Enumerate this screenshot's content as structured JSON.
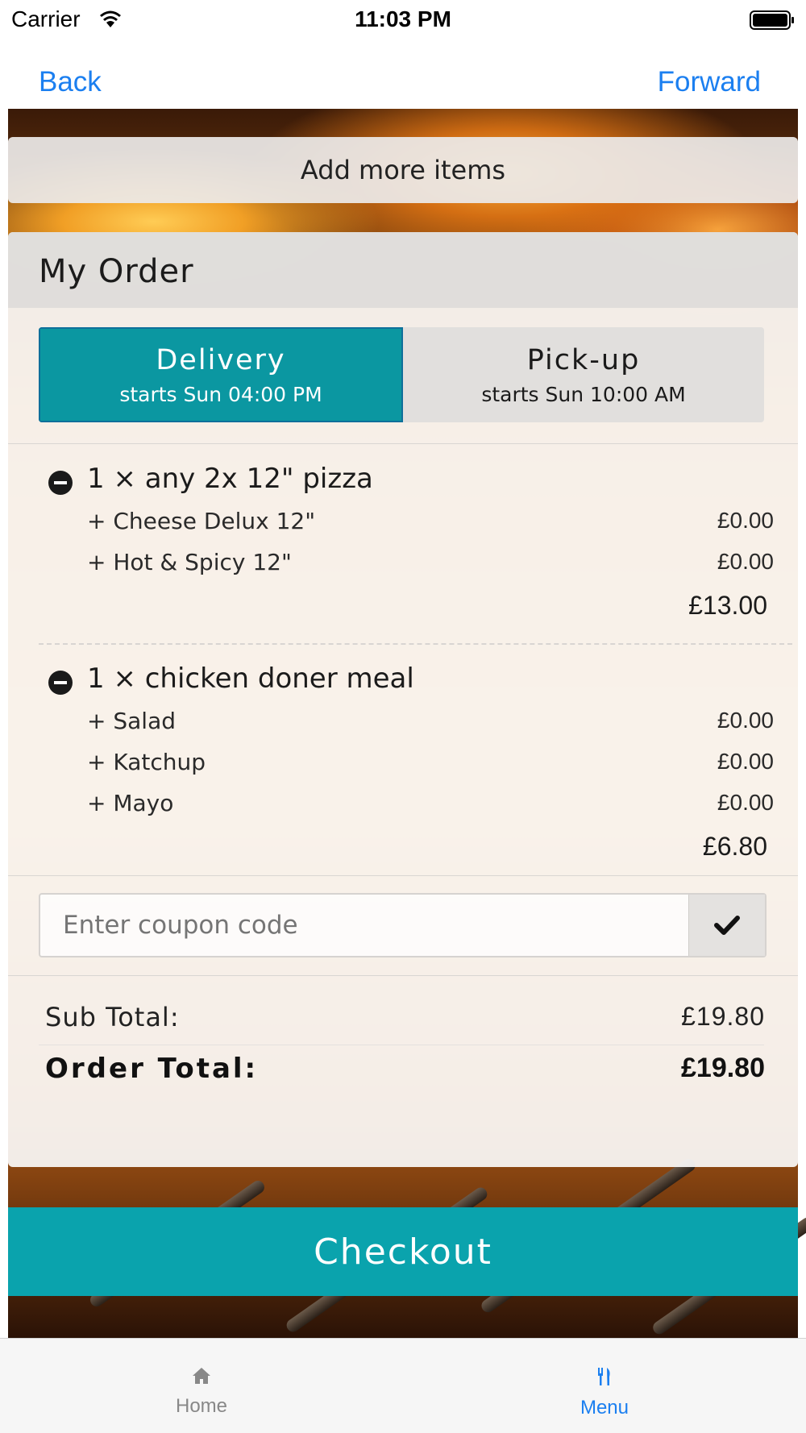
{
  "status_bar": {
    "carrier": "Carrier",
    "time": "11:03 PM"
  },
  "nav": {
    "back": "Back",
    "forward": "Forward"
  },
  "add_more_label": "Add more items",
  "order": {
    "title": "My Order",
    "delivery": {
      "title": "Delivery",
      "subtitle": "starts Sun 04:00 PM",
      "selected": true
    },
    "pickup": {
      "title": "Pick-up",
      "subtitle": "starts Sun 10:00 AM",
      "selected": false
    },
    "items": [
      {
        "title": "1 × any 2x 12\" pizza",
        "options": [
          {
            "name": "+ Cheese Delux 12\"",
            "price": "£0.00"
          },
          {
            "name": "+ Hot & Spicy 12\"",
            "price": "£0.00"
          }
        ],
        "total": "£13.00"
      },
      {
        "title": "1 × chicken doner meal",
        "options": [
          {
            "name": "+ Salad",
            "price": "£0.00"
          },
          {
            "name": "+ Katchup",
            "price": "£0.00"
          },
          {
            "name": "+ Mayo",
            "price": "£0.00"
          }
        ],
        "total": "£6.80"
      }
    ],
    "coupon": {
      "placeholder": "Enter coupon code",
      "value": ""
    },
    "sub_total_label": "Sub Total:",
    "sub_total": "£19.80",
    "order_total_label": "Order Total:",
    "order_total": "£19.80"
  },
  "checkout_label": "Checkout",
  "tabs": [
    {
      "label": "Home",
      "icon": "home-icon",
      "active": false
    },
    {
      "label": "Menu",
      "icon": "fork-knife-icon",
      "active": true
    }
  ],
  "colors": {
    "accent": "#0aa3ad",
    "link": "#1b7ff0"
  }
}
